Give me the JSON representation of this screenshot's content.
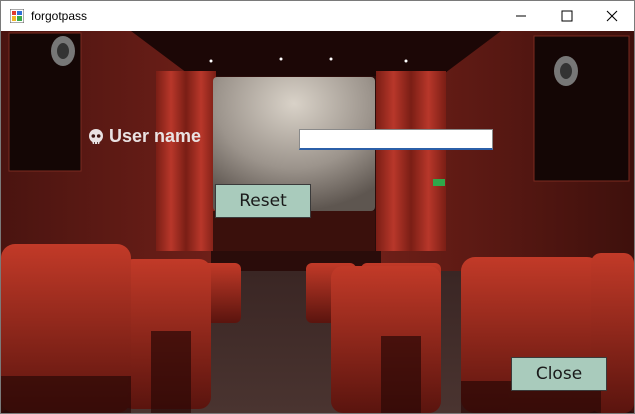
{
  "window": {
    "title": "forgotpass",
    "controls": {
      "minimize_icon": "minimize-icon",
      "maximize_icon": "maximize-icon",
      "close_icon": "close-icon"
    }
  },
  "form": {
    "username_label": "User name",
    "username_icon": "skull-icon",
    "username_value": "",
    "reset_label": "Reset",
    "close_label": "Close"
  },
  "colors": {
    "button_bg": "#a9cbbc",
    "label_text": "#e9e2e2",
    "input_focus_border": "#2b5fa8"
  }
}
